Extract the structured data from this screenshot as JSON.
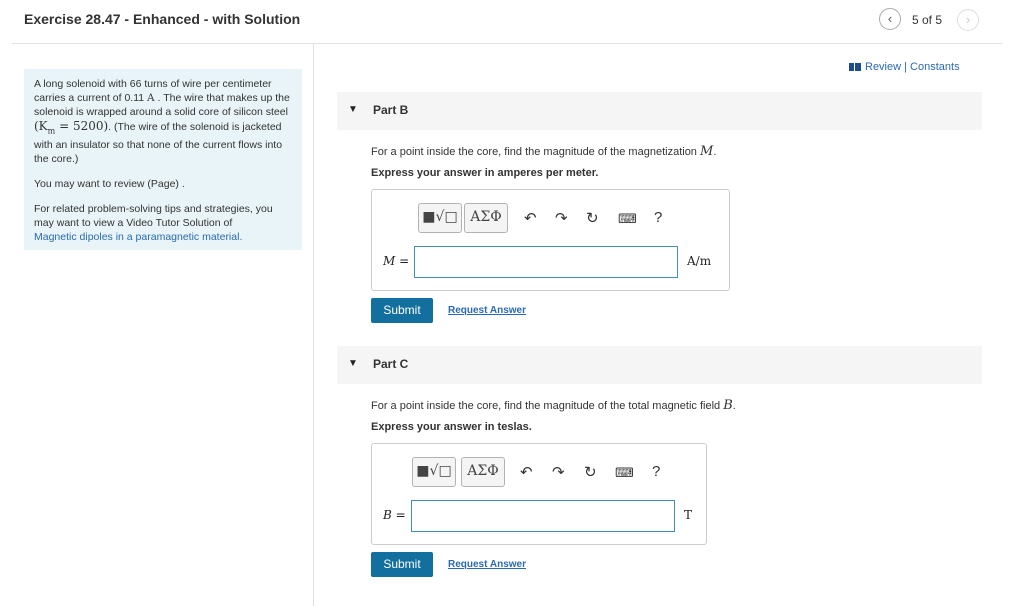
{
  "header": {
    "title": "Exercise 28.47 - Enhanced - with Solution",
    "page_count": "5 of 5"
  },
  "nav": {
    "prev_icon": "chevron-left",
    "next_icon": "chevron-right"
  },
  "review_link": "Review | Constants",
  "problem": {
    "text1": "A long solenoid with 66 turns of wire per centimeter carries a current of 0.11",
    "unit_A": "A",
    "text2": ". The wire that makes up the solenoid is wrapped around a solid core of silicon steel",
    "km": "(K",
    "km_sub": "m",
    "km_val": "= 5200)",
    "text3": ". (The wire of the solenoid is jacketed with an insulator so that none of the current flows into the core.)",
    "review_text": "You may want to review (Page) .",
    "tips_text": "For related problem-solving tips and strategies, you may want to view a Video Tutor Solution of",
    "tips_link": "Magnetic dipoles in a paramagnetic material."
  },
  "parts": [
    {
      "label": "Part B",
      "question": "For a point inside the core, find the magnitude of the magnetization",
      "symbol": "M",
      "suffix": ".",
      "express": "Express your answer in amperes per meter.",
      "answer_label": "M =",
      "answer_value": "",
      "unit": "A/m",
      "submit": "Submit",
      "request": "Request Answer"
    },
    {
      "label": "Part C",
      "question": "For a point inside the core, find the magnitude of the total magnetic field",
      "symbol": "B",
      "suffix": ".",
      "express": "Express your answer in teslas.",
      "answer_label": "B =",
      "answer_value": "",
      "unit": "T",
      "submit": "Submit",
      "request": "Request Answer"
    }
  ],
  "toolbar": {
    "template_btn": "■√□",
    "greek_btn": "ΑΣΦ",
    "help": "?"
  },
  "colors": {
    "accent": "#136f9e",
    "link": "#2a6ab1",
    "panel": "#e8f4f7",
    "input_border": "#3f91b1"
  }
}
